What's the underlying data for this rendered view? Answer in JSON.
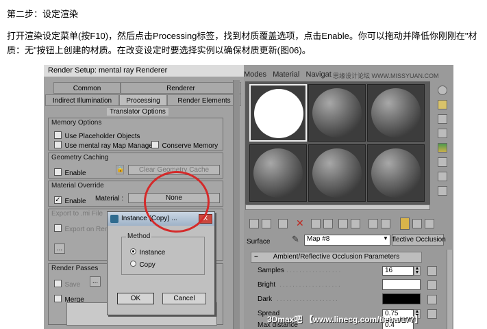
{
  "article": {
    "step_title": "第二步：设定渲染",
    "paragraph": "打开渲染设定菜单(按F10)，然后点击Processing标签，找到材质覆盖选项，点击Enable。你可以拖动并降低你刚刚在\"材质：无\"按钮上创建的材质。在改变设定时要选择实例以确保材质更新(图06)。"
  },
  "render_setup": {
    "title": "Render Setup: mental ray Renderer",
    "tabs_row1": [
      "Common",
      "Renderer"
    ],
    "tabs_row2": [
      "Indirect Illumination",
      "Processing",
      "Render Elements"
    ],
    "active_tab": "Processing",
    "rollout": "Translator Options",
    "memory": {
      "title": "Memory Options",
      "placeholder_objects": "Use Placeholder Objects",
      "map_manager": "Use mental ray Map Manager",
      "conserve_memory": "Conserve Memory"
    },
    "geometry_caching": {
      "title": "Geometry Caching",
      "enable": "Enable",
      "clear_button": "Clear Geometry Cache"
    },
    "material_override": {
      "title": "Material Override",
      "enable": "Enable",
      "material_label": "Material :",
      "material_button": "None"
    },
    "export": {
      "title": "Export to .mi File",
      "export_on_render": "Export on Render",
      "browse": "..."
    },
    "render_passes": {
      "title": "Render Passes",
      "save": "Save",
      "browse": "...",
      "merge": "Merge"
    }
  },
  "dialog": {
    "title": "Instance (Copy) ...",
    "close": "X",
    "method_title": "Method",
    "options": [
      "Instance",
      "Copy"
    ],
    "selected": "Instance",
    "ok": "OK",
    "cancel": "Cancel"
  },
  "material_editor": {
    "menu": [
      "Modes",
      "Material",
      "Navigat"
    ],
    "surface_label": "Surface",
    "map_name": "Map #8",
    "map_type": "flective Occlusion",
    "params_title": "Ambient/Reflective Occlusion Parameters",
    "params": [
      {
        "label": "Samples",
        "value": "16"
      },
      {
        "label": "Bright",
        "value": ""
      },
      {
        "label": "Dark",
        "value": ""
      },
      {
        "label": "Spread",
        "value": "0.75"
      },
      {
        "label": "Max distance",
        "value": "0.4"
      }
    ],
    "colors": {
      "bright": "#ffffff",
      "dark": "#000000"
    }
  },
  "watermarks": {
    "top": "思缘设计论坛 WWW.MISSYUAN.COM",
    "bottom": "3Dmax吧 【www.linecg.com/tieba/177】"
  },
  "accent_color": "#d42a2a"
}
